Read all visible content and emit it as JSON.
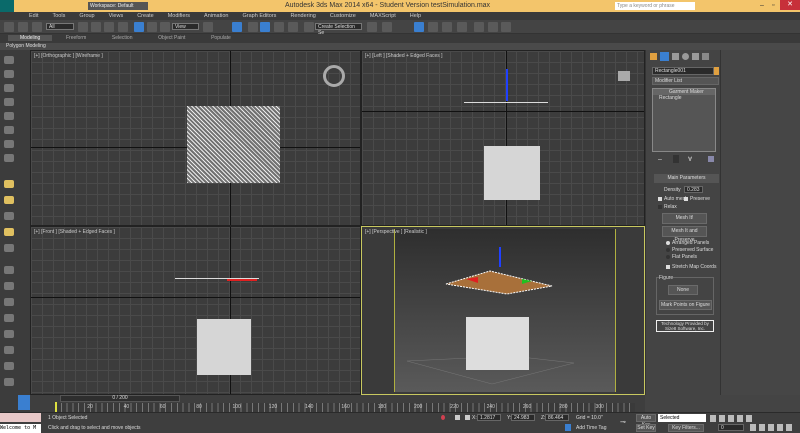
{
  "titlebar": {
    "workspace": "Workspace: Default",
    "title": "Autodesk 3ds Max  2014 x64   - Student Version    testSimulation.max",
    "search_placeholder": "Type a keyword or phrase"
  },
  "menu": [
    "Edit",
    "Tools",
    "Group",
    "Views",
    "Create",
    "Modifiers",
    "Animation",
    "Graph Editors",
    "Rendering",
    "Customize",
    "MAXScript",
    "Help"
  ],
  "toolbar": {
    "filter": "All",
    "ref_coord": "View",
    "selection_set": "Create Selection Se"
  },
  "ribbon": {
    "tabs": [
      "Modeling",
      "Freeform",
      "Selection",
      "Object Paint",
      "Populate"
    ],
    "active": "Modeling",
    "sub": "Polygon Modeling"
  },
  "viewports": [
    {
      "label": "[+] [Orthographic ] [Wireframe ]"
    },
    {
      "label": "[+] [Left ] [Shaded + Edged Faces ]"
    },
    {
      "label": "[+] [Front ] [Shaded + Edged Faces ]"
    },
    {
      "label": "[+] [Perspective ] [Realistic ]"
    }
  ],
  "command_panel": {
    "object_name": "Rectangle001",
    "modifier_list": "Modifier List",
    "stack": [
      "Garment Maker",
      "Rectangle"
    ],
    "rollout": "Main Parameters",
    "density_label": "Density",
    "density": "0.283",
    "auto_mesh": "Auto mesh",
    "preserve": "Preserve",
    "relax": "Relax",
    "mesh_it": "Mesh It!",
    "mesh_it_preserve": "Mesh It and Preserve",
    "radios": [
      "Arranged Panels",
      "Preserved Surface",
      "Flat Panels"
    ],
    "stretch": "Stretch Map Coords",
    "figure_group": "Figure",
    "none_btn": "None",
    "mark_points": "Mark Points on Figure",
    "tech": "Technology Provided by",
    "tech2": "Size8 Software, Inc."
  },
  "timeline": {
    "frame": "0 / 200",
    "ticks": [
      "0",
      "20",
      "40",
      "60",
      "80",
      "100",
      "120",
      "140",
      "160",
      "180",
      "200",
      "220",
      "240",
      "260",
      "280",
      "300"
    ]
  },
  "status": {
    "selected": "1 Object Selected",
    "prompt": "Click and drag to select and move objects",
    "maxscript": "Welcome to M",
    "x": "1.2817",
    "y": "24.983",
    "z": "86.464",
    "grid": "Grid = 10.0\"",
    "add_time_tag": "Add Time Tag",
    "auto_key": "Auto Key",
    "key_mode": "Selected",
    "set_key": "Set Key",
    "key_filters": "Key Filters...",
    "frame_field": "0"
  }
}
